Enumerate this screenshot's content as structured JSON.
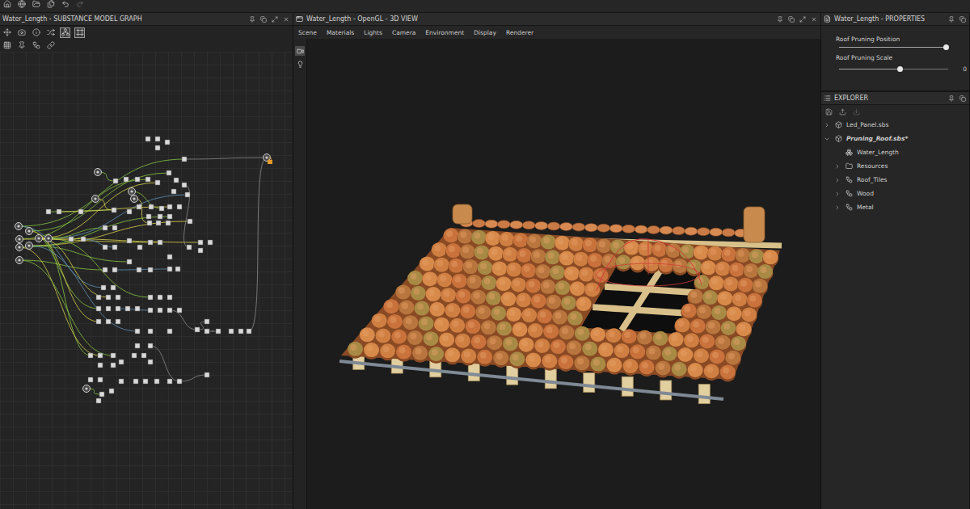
{
  "graph_panel": {
    "title": "Water_Length - SUBSTANCE MODEL GRAPH",
    "toolbar": [
      {
        "kind": "move",
        "row": 1,
        "selected": false
      },
      {
        "kind": "camera",
        "row": 1,
        "selected": false
      },
      {
        "kind": "info",
        "row": 1,
        "selected": false
      },
      {
        "kind": "shuffle",
        "row": 1,
        "selected": false
      },
      {
        "kind": "tree",
        "row": 1,
        "selected": true
      },
      {
        "kind": "frame",
        "row": 1,
        "selected": true
      },
      {
        "kind": "grid",
        "row": 2,
        "selected": false
      },
      {
        "kind": "pin",
        "row": 2,
        "selected": false
      },
      {
        "kind": "nodes",
        "row": 2,
        "selected": false
      },
      {
        "kind": "link",
        "row": 2,
        "selected": false
      }
    ]
  },
  "view_panel": {
    "title": "Water_Length - OpenGL - 3D VIEW",
    "menu": [
      "Scene",
      "Materials",
      "Lights",
      "Camera",
      "Environment",
      "Display",
      "Renderer"
    ],
    "tools": [
      {
        "kind": "camera",
        "selected": true
      },
      {
        "kind": "light",
        "selected": false
      }
    ]
  },
  "properties_panel": {
    "title": "Water_Length - PROPERTIES",
    "sliders": [
      {
        "label": "Roof Pruning Position",
        "level": 0.98
      },
      {
        "label": "Roof Pruning Scale",
        "level": 0.56,
        "reading": "0"
      }
    ]
  },
  "explorer": {
    "title": "EXPLORER",
    "items": [
      {
        "label": "Led_Panel.sbs",
        "kind": "package",
        "depth": 0,
        "expandable": true,
        "expanded": false,
        "modified": false
      },
      {
        "label": "Pruning_Roof.sbs*",
        "kind": "package",
        "depth": 0,
        "expandable": true,
        "expanded": true,
        "modified": true
      },
      {
        "label": "Water_Length",
        "kind": "model-graph",
        "depth": 1,
        "expandable": false,
        "expanded": false,
        "modified": false
      },
      {
        "label": "Resources",
        "kind": "folder",
        "depth": 1,
        "expandable": true,
        "expanded": false,
        "modified": false
      },
      {
        "label": "Roof_Tiles",
        "kind": "graph",
        "depth": 1,
        "expandable": true,
        "expanded": false,
        "modified": false
      },
      {
        "label": "Wood",
        "kind": "graph",
        "depth": 1,
        "expandable": true,
        "expanded": false,
        "modified": false
      },
      {
        "label": "Metal",
        "kind": "graph",
        "depth": 1,
        "expandable": true,
        "expanded": false,
        "modified": false
      }
    ]
  }
}
